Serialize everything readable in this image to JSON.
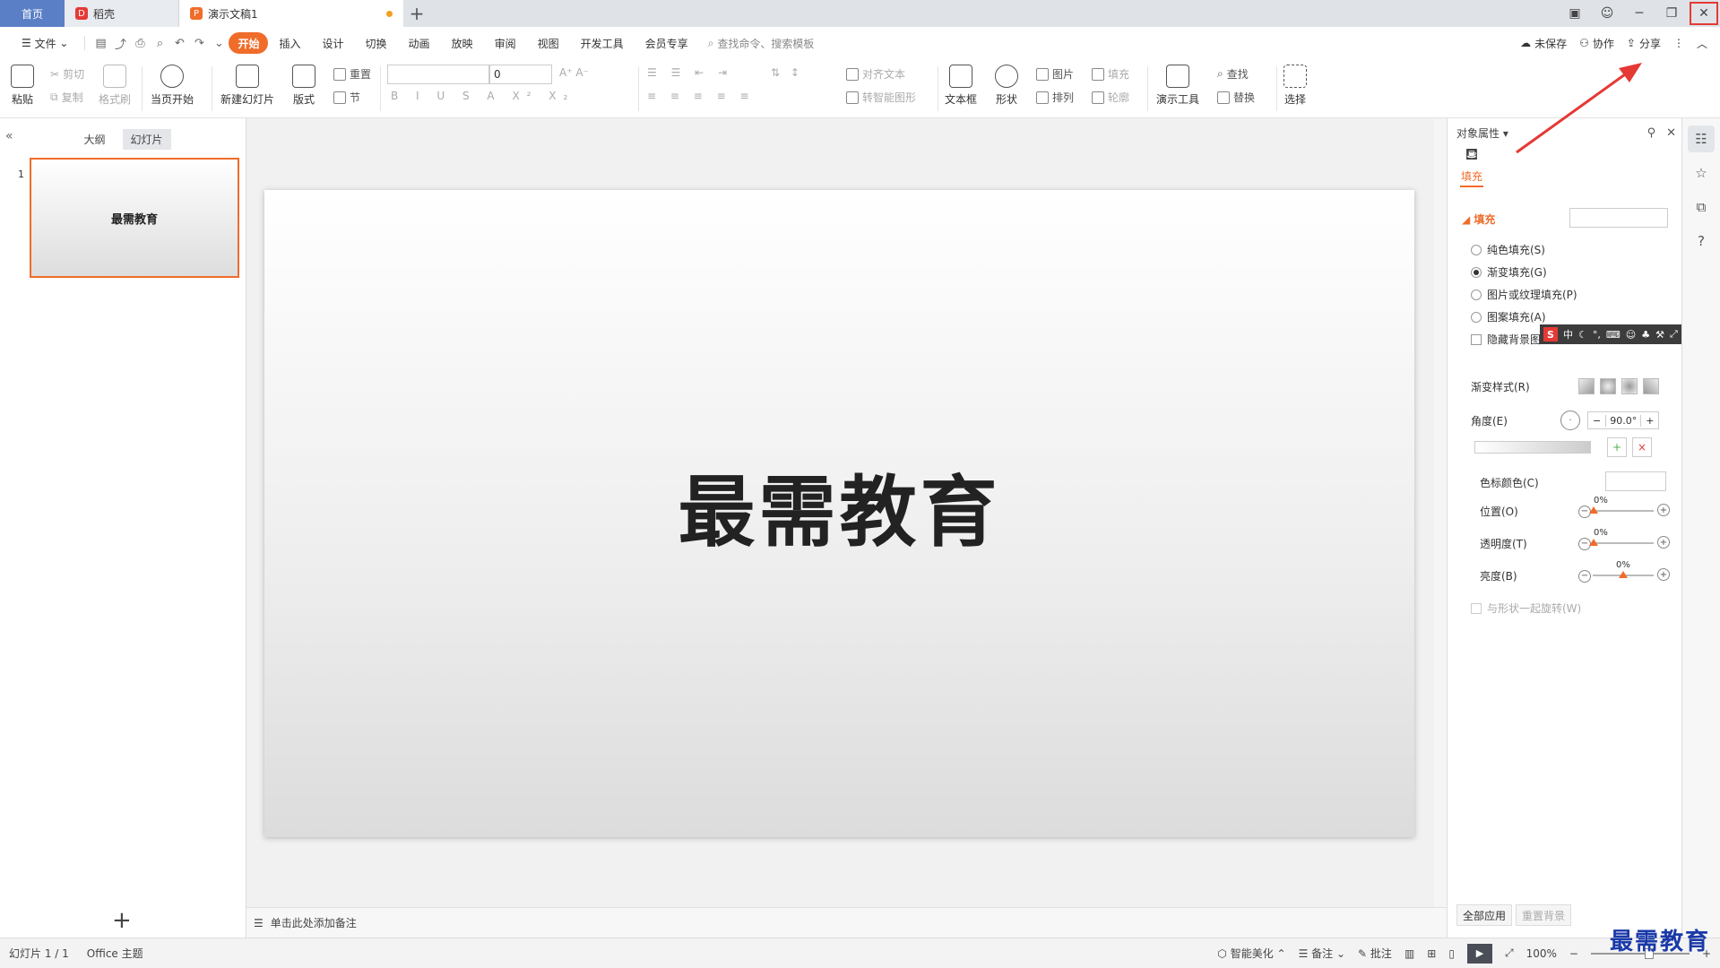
{
  "tabs": {
    "home": "首页",
    "daoke": "稻壳",
    "document": "演示文稿1"
  },
  "menu": {
    "file": "文件",
    "items": [
      "开始",
      "插入",
      "设计",
      "切换",
      "动画",
      "放映",
      "审阅",
      "视图",
      "开发工具",
      "会员专享"
    ],
    "search_placeholder": "查找命令、搜索模板",
    "unsaved": "未保存",
    "collab": "协作",
    "share": "分享"
  },
  "ribbon": {
    "paste": "粘贴",
    "cut": "剪切",
    "copy": "复制",
    "format_painter": "格式刷",
    "play_from_current": "当页开始",
    "new_slide": "新建幻灯片",
    "layout": "版式",
    "reset": "重置",
    "section": "节",
    "font_size": "0",
    "align_text": "对齐文本",
    "smartart": "转智能图形",
    "textbox": "文本框",
    "shape": "形状",
    "picture": "图片",
    "fill": "填充",
    "arrange": "排列",
    "outline": "轮廓",
    "present_tools": "演示工具",
    "find": "查找",
    "replace": "替换",
    "select": "选择"
  },
  "left_panel": {
    "outline_tab": "大纲",
    "slides_tab": "幻灯片",
    "slide_number": "1",
    "thumb_title": "最需教育"
  },
  "slide": {
    "title": "最需教育"
  },
  "notes": {
    "placeholder": "单击此处添加备注"
  },
  "right_panel": {
    "title": "对象属性",
    "fill_tab": "填充",
    "fill_section": "填充",
    "solid_fill": "纯色填充(S)",
    "gradient_fill": "渐变填充(G)",
    "picture_fill": "图片或纹理填充(P)",
    "pattern_fill": "图案填充(A)",
    "hide_bg": "隐藏背景图",
    "gradient_style": "渐变样式(R)",
    "angle_label": "角度(E)",
    "angle_value": "90.0°",
    "stop_color": "色标颜色(C)",
    "position_label": "位置(O)",
    "position_value": "0%",
    "transparency_label": "透明度(T)",
    "transparency_value": "0%",
    "brightness_label": "亮度(B)",
    "brightness_value": "0%",
    "rotate_with_shape": "与形状一起旋转(W)",
    "apply_all": "全部应用",
    "reset_bg": "重置背景"
  },
  "ime": {
    "mode": "中"
  },
  "status": {
    "slide_info": "幻灯片 1 / 1",
    "theme": "Office 主题",
    "beautify": "智能美化",
    "notes": "备注",
    "comments": "批注",
    "zoom": "100%"
  },
  "watermark": "最需教育",
  "colors": {
    "accent": "#f06c2a",
    "home_tab": "#5b7fc7",
    "highlight": "#e53935"
  }
}
